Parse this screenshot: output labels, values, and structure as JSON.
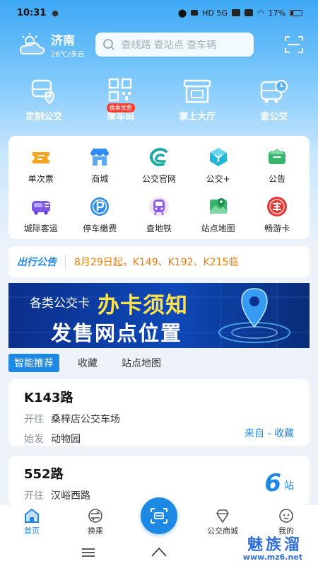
{
  "status_bar": {
    "time": "10:31",
    "battery": "17%",
    "network": "HD 5G"
  },
  "header": {
    "city": "济南",
    "weather": "28℃/多云",
    "search_placeholder": "查线路 查站点 查车辆"
  },
  "quick_actions": [
    {
      "label": "定制公交",
      "icon": "custom-bus-icon"
    },
    {
      "label": "乘车码",
      "icon": "qr-code-icon",
      "badge": "换乘优惠"
    },
    {
      "label": "掌上大厅",
      "icon": "service-hall-icon"
    },
    {
      "label": "查公交",
      "icon": "bus-clock-icon"
    }
  ],
  "grid_items": [
    {
      "label": "单次票",
      "icon": "ticket-icon",
      "color": "#f7a31c"
    },
    {
      "label": "商城",
      "icon": "store-icon",
      "color": "#2f8cf0"
    },
    {
      "label": "公交官网",
      "icon": "website-icon",
      "color": "#1aa9a0"
    },
    {
      "label": "公交+",
      "icon": "bus-plus-icon",
      "color": "#22b7d9"
    },
    {
      "label": "公告",
      "icon": "notice-icon",
      "color": "#36b46b"
    },
    {
      "label": "城际客运",
      "icon": "intercity-icon",
      "color": "#7b57e8"
    },
    {
      "label": "停车缴费",
      "icon": "parking-icon",
      "color": "#2f8cf0"
    },
    {
      "label": "查地铁",
      "icon": "metro-icon",
      "color": "#8e5ae8"
    },
    {
      "label": "站点地图",
      "icon": "map-icon",
      "color": "#36b46b"
    },
    {
      "label": "畅游卡",
      "icon": "tour-card-icon",
      "color": "#e53935"
    }
  ],
  "notice": {
    "logo": "出行公告",
    "text": "8月29日起，K149、K192、K215临"
  },
  "banner": {
    "line1": "各类公交卡",
    "line1_highlight": "办卡须知",
    "line2": "发售网点位置"
  },
  "tabs": [
    {
      "label": "智能推荐",
      "active": true
    },
    {
      "label": "收藏",
      "active": false
    },
    {
      "label": "站点地图",
      "active": false
    }
  ],
  "routes": [
    {
      "name": "K143路",
      "to_label": "开往",
      "to": "桑梓店公交车场",
      "from_label": "始发",
      "from": "动物园",
      "source": "来自 - 收藏"
    },
    {
      "name": "552路",
      "to_label": "开往",
      "to": "汉峪西路",
      "stops_num": "6",
      "stops_unit": "站"
    }
  ],
  "bottom_nav": [
    {
      "label": "首页",
      "active": true
    },
    {
      "label": "换乘",
      "active": false
    },
    {
      "label": "",
      "center": true
    },
    {
      "label": "公交商城",
      "active": false
    },
    {
      "label": "我的",
      "active": false
    }
  ],
  "watermark": {
    "line1": "魅族溜",
    "line2": "www.mz6.net"
  }
}
